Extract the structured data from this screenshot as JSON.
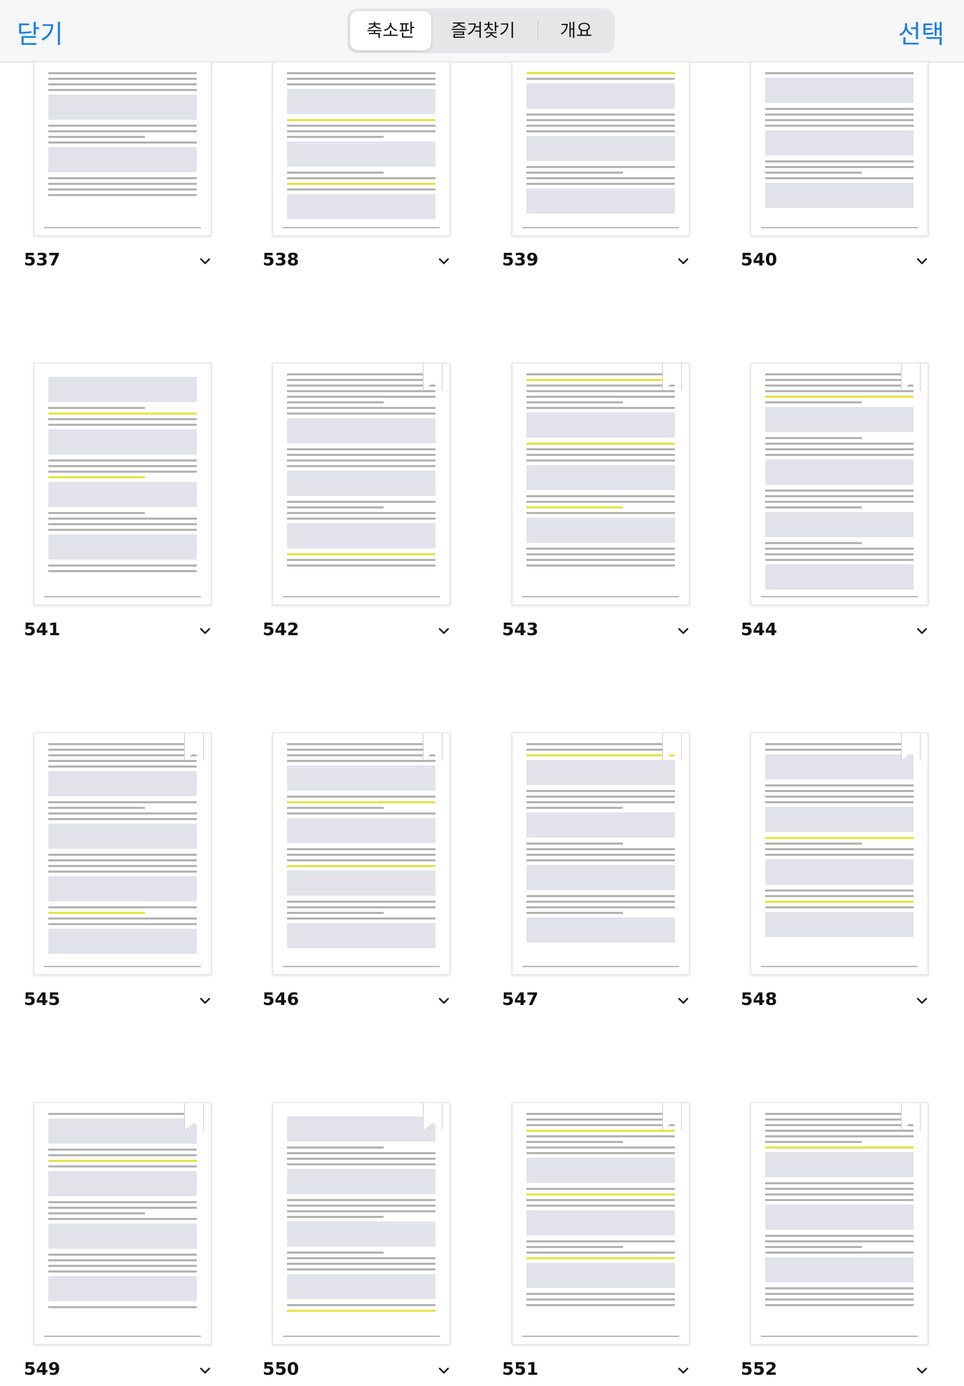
{
  "toolbar": {
    "close_label": "닫기",
    "select_label": "선택",
    "tabs": [
      {
        "label": "축소판",
        "active": true
      },
      {
        "label": "즐겨찾기",
        "active": false
      },
      {
        "label": "개요",
        "active": false
      }
    ]
  },
  "pages": [
    {
      "number": "537",
      "bookmark": false
    },
    {
      "number": "538",
      "bookmark": false
    },
    {
      "number": "539",
      "bookmark": false
    },
    {
      "number": "540",
      "bookmark": false
    },
    {
      "number": "541",
      "bookmark": false
    },
    {
      "number": "542",
      "bookmark": true
    },
    {
      "number": "543",
      "bookmark": true
    },
    {
      "number": "544",
      "bookmark": true
    },
    {
      "number": "545",
      "bookmark": true
    },
    {
      "number": "546",
      "bookmark": true
    },
    {
      "number": "547",
      "bookmark": true
    },
    {
      "number": "548",
      "bookmark": true
    },
    {
      "number": "549",
      "bookmark": true
    },
    {
      "number": "550",
      "bookmark": true
    },
    {
      "number": "551",
      "bookmark": true
    },
    {
      "number": "552",
      "bookmark": true
    }
  ],
  "colors": {
    "accent": "#1a7fe0",
    "highlight": "#e5e23a"
  },
  "icons": {
    "expand": "chevron-down-icon",
    "bookmark": "bookmark-icon"
  }
}
